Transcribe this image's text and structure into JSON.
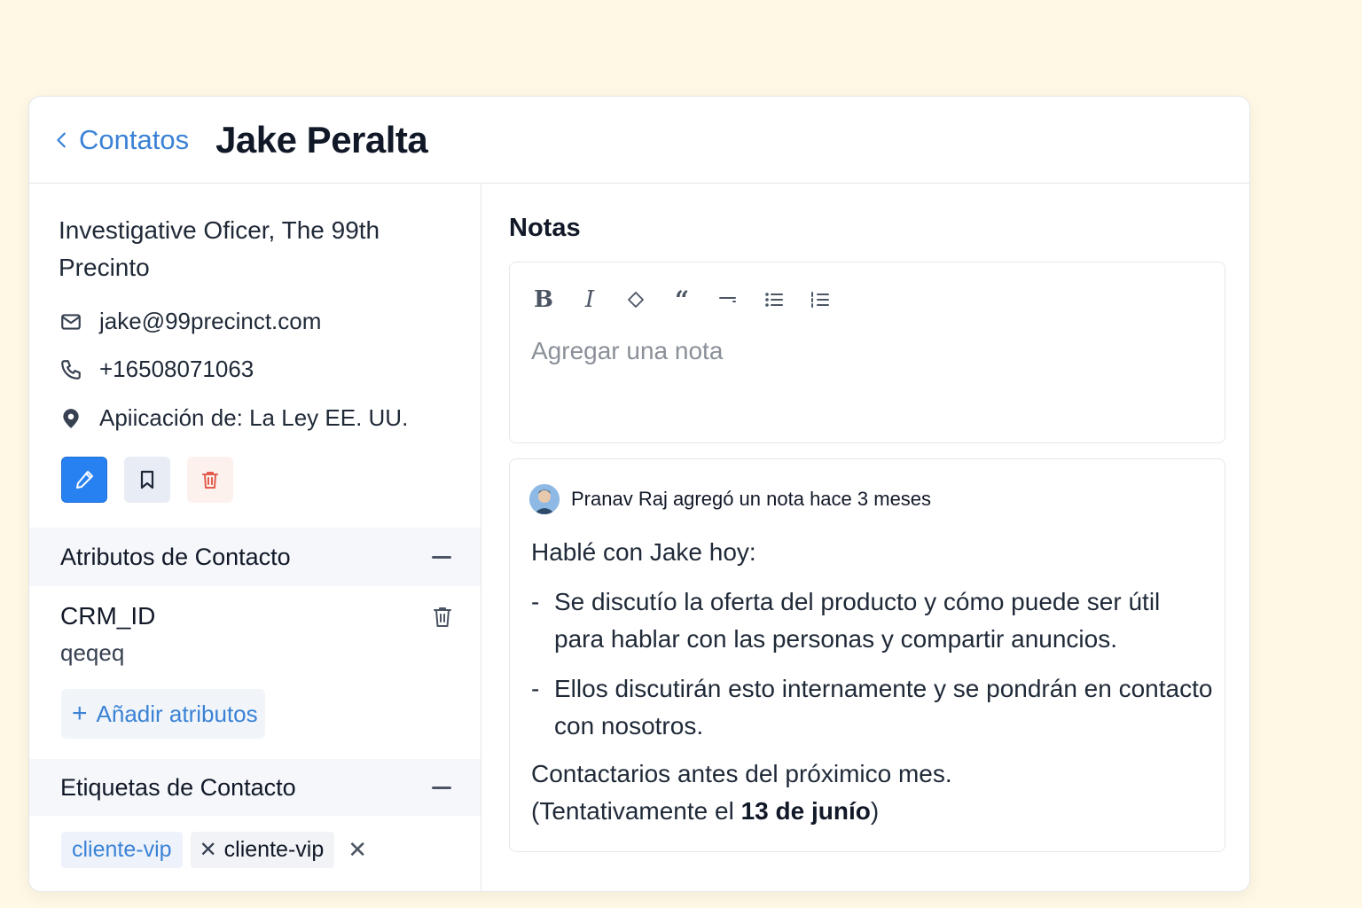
{
  "header": {
    "back_label": "Contatos",
    "title": "Jake Peralta"
  },
  "contact": {
    "job": "Investigative Oficer, The 99th Precinto",
    "email": "jake@99precinct.com",
    "phone": "+16508071063",
    "location": "Apiicación de: La Ley EE. UU."
  },
  "attributes": {
    "section_label": "Atributos de Contacto",
    "items": [
      {
        "name": "CRM_ID",
        "value": "qeqeq"
      }
    ],
    "add_label": "Añadir atributos"
  },
  "labels": {
    "section_label": "Etiquetas de Contacto",
    "tags": [
      "cliente-vip",
      "cliente-vip"
    ]
  },
  "notes": {
    "title": "Notas",
    "placeholder": "Agregar una nota",
    "toolbar": [
      "bold",
      "italic",
      "code",
      "quote",
      "horizontal-rule",
      "bullet-list",
      "ordered-list"
    ],
    "entry": {
      "meta": "Pranav Raj agregó un nota hace 3 meses",
      "intro": "Hablé con Jake hoy:",
      "bullets": [
        "Se discutío la oferta del producto y cómo puede ser útil para hablar con las personas y compartir anuncios.",
        "Ellos discutirán esto internamente y se pondrán en contacto con nosotros."
      ],
      "closing_line1": "Contactarios antes del próximico mes.",
      "closing_prefix": "(Tentativamente el ",
      "closing_bold": "13 de junío",
      "closing_suffix": ")"
    }
  },
  "colors": {
    "accent": "#3b82d6",
    "primary_button": "#2781f0",
    "danger": "#e35d4f",
    "page_bg": "#fef8e4"
  }
}
